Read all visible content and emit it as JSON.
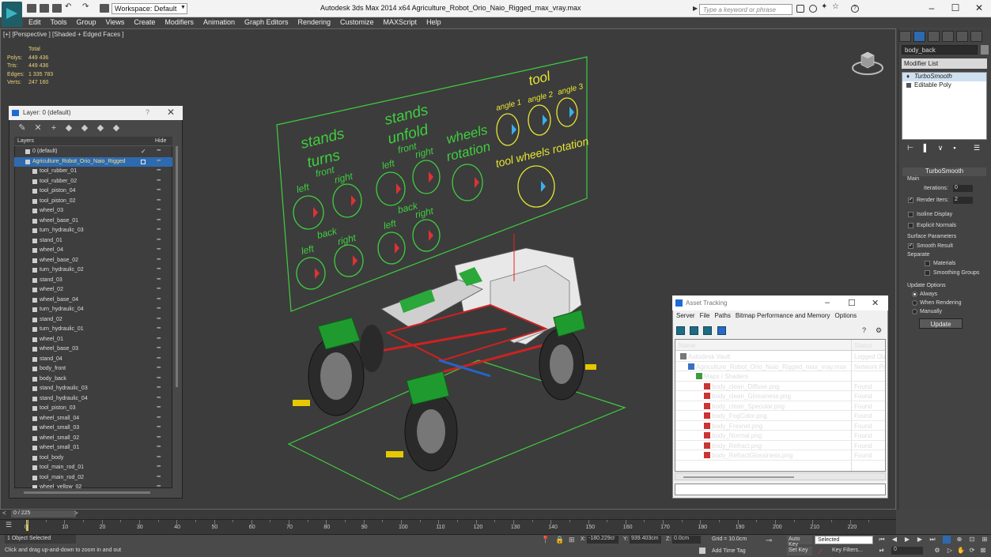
{
  "titlebar": {
    "workspace": "Workspace: Default",
    "title": "Autodesk 3ds Max  2014 x64      Agriculture_Robot_Orio_Naio_Rigged_max_vray.max",
    "search_placeholder": "Type a keyword or phrase"
  },
  "menu": [
    "Edit",
    "Tools",
    "Group",
    "Views",
    "Create",
    "Modifiers",
    "Animation",
    "Graph Editors",
    "Rendering",
    "Customize",
    "MAXScript",
    "Help"
  ],
  "viewport": {
    "label": "[+] [Perspective ] [Shaded + Edged Faces ]",
    "stats": {
      "header": "Total",
      "rows": [
        {
          "label": "Polys:",
          "value": "449 436"
        },
        {
          "label": "Tris:",
          "value": "449 436"
        },
        {
          "label": "Edges:",
          "value": "1 335 783"
        },
        {
          "label": "Verts:",
          "value": "247 160"
        }
      ]
    },
    "board": {
      "stands_turns_1": "stands",
      "stands_turns_2": "turns",
      "stands_unfold_1": "stands",
      "stands_unfold_2": "unfold",
      "wheels_1": "wheels",
      "wheels_2": "rotation",
      "tool": "tool",
      "tool_wheels": "tool wheels rotation",
      "angle1": "angle 1",
      "angle2": "angle 2",
      "angle3": "angle 3",
      "front": "front",
      "back": "back",
      "left": "left",
      "right": "right"
    }
  },
  "command_panel": {
    "object_name": "body_back",
    "modifier_list": "Modifier List",
    "stack": [
      "TurboSmooth",
      "Editable Poly"
    ],
    "rollout": "TurboSmooth",
    "main": "Main",
    "iterations_label": "Iterations:",
    "iterations": "0",
    "render_iters_label": "Render Iters:",
    "render_iters": "2",
    "isoline": "Isoline Display",
    "explicit": "Explicit Normals",
    "surface": "Surface Parameters",
    "smooth_result": "Smooth Result",
    "separate": "Separate",
    "materials": "Materials",
    "smoothing_groups": "Smoothing Groups",
    "update_options": "Update Options",
    "always": "Always",
    "when_rendering": "When Rendering",
    "manually": "Manually",
    "update": "Update"
  },
  "layer_dialog": {
    "title": "Layer: 0 (default)",
    "col_layers": "Layers",
    "col_hide": "Hide",
    "rows": [
      {
        "name": "0 (default)",
        "level": 0
      },
      {
        "name": "Agriculture_Robot_Orio_Naio_Rigged",
        "level": 0,
        "selected": true
      },
      {
        "name": "tool_rubber_01",
        "level": 1
      },
      {
        "name": "tool_rubber_02",
        "level": 1
      },
      {
        "name": "tool_piston_04",
        "level": 1
      },
      {
        "name": "tool_piston_02",
        "level": 1
      },
      {
        "name": "wheel_03",
        "level": 1
      },
      {
        "name": "wheel_base_01",
        "level": 1
      },
      {
        "name": "turn_hydraulic_03",
        "level": 1
      },
      {
        "name": "stand_01",
        "level": 1
      },
      {
        "name": "wheel_04",
        "level": 1
      },
      {
        "name": "wheel_base_02",
        "level": 1
      },
      {
        "name": "turn_hydraulic_02",
        "level": 1
      },
      {
        "name": "stand_03",
        "level": 1
      },
      {
        "name": "wheel_02",
        "level": 1
      },
      {
        "name": "wheel_base_04",
        "level": 1
      },
      {
        "name": "turn_hydraulic_04",
        "level": 1
      },
      {
        "name": "stand_02",
        "level": 1
      },
      {
        "name": "turn_hydraulic_01",
        "level": 1
      },
      {
        "name": "wheel_01",
        "level": 1
      },
      {
        "name": "wheel_base_03",
        "level": 1
      },
      {
        "name": "stand_04",
        "level": 1
      },
      {
        "name": "body_front",
        "level": 1
      },
      {
        "name": "body_back",
        "level": 1
      },
      {
        "name": "stand_hydraulic_03",
        "level": 1
      },
      {
        "name": "stand_hydraulic_04",
        "level": 1
      },
      {
        "name": "tool_piston_03",
        "level": 1
      },
      {
        "name": "wheel_small_04",
        "level": 1
      },
      {
        "name": "wheel_small_03",
        "level": 1
      },
      {
        "name": "wheel_small_02",
        "level": 1
      },
      {
        "name": "wheel_small_01",
        "level": 1
      },
      {
        "name": "tool_body",
        "level": 1
      },
      {
        "name": "tool_main_rod_01",
        "level": 1
      },
      {
        "name": "tool_main_rod_02",
        "level": 1
      },
      {
        "name": "wheel_yellow_02",
        "level": 1
      }
    ]
  },
  "asset_tracking": {
    "title": "Asset Tracking",
    "menu": [
      "Server",
      "File",
      "Paths",
      "Bitmap Performance and Memory",
      "Options"
    ],
    "col_name": "Name",
    "col_status": "Status",
    "rows": [
      {
        "name": "Autodesk Vault",
        "status": "Logged Out",
        "indent": 0
      },
      {
        "name": "Agriculture_Robot_Orio_Naio_Rigged_max_vray.max",
        "status": "Network Pa",
        "indent": 1
      },
      {
        "name": "Maps / Shaders",
        "status": "",
        "indent": 2
      },
      {
        "name": "body_clean_Diffuse.png",
        "status": "Found",
        "indent": 3
      },
      {
        "name": "body_clean_Glossiness.png",
        "status": "Found",
        "indent": 3
      },
      {
        "name": "body_clean_Specular.png",
        "status": "Found",
        "indent": 3
      },
      {
        "name": "body_FogColor.png",
        "status": "Found",
        "indent": 3
      },
      {
        "name": "body_Fresnel.png",
        "status": "Found",
        "indent": 3
      },
      {
        "name": "body_Normal.png",
        "status": "Found",
        "indent": 3
      },
      {
        "name": "body_Refract.png",
        "status": "Found",
        "indent": 3
      },
      {
        "name": "body_RefractGlossiness.png",
        "status": "Found",
        "indent": 3
      }
    ]
  },
  "timeline": {
    "frame": "0 / 225",
    "ticks": [
      "0",
      "10",
      "20",
      "30",
      "40",
      "50",
      "60",
      "70",
      "80",
      "90",
      "100",
      "110",
      "120",
      "130",
      "140",
      "150",
      "160",
      "170",
      "180",
      "190",
      "200",
      "210",
      "220"
    ]
  },
  "status": {
    "selection": "1 Object Selected",
    "prompt": "Click and drag up-and-down to zoom in and out",
    "x_label": "X:",
    "x": "-180.229cr",
    "y_label": "Y:",
    "y": "939.403cm",
    "z_label": "Z:",
    "z": "0.0cm",
    "grid": "Grid = 10.0cm",
    "add_time_tag": "Add Time Tag",
    "auto_key": "Auto Key",
    "set_key": "Set Key",
    "selected": "Selected",
    "key_filters": "Key Filters...",
    "frame_value": "0"
  }
}
